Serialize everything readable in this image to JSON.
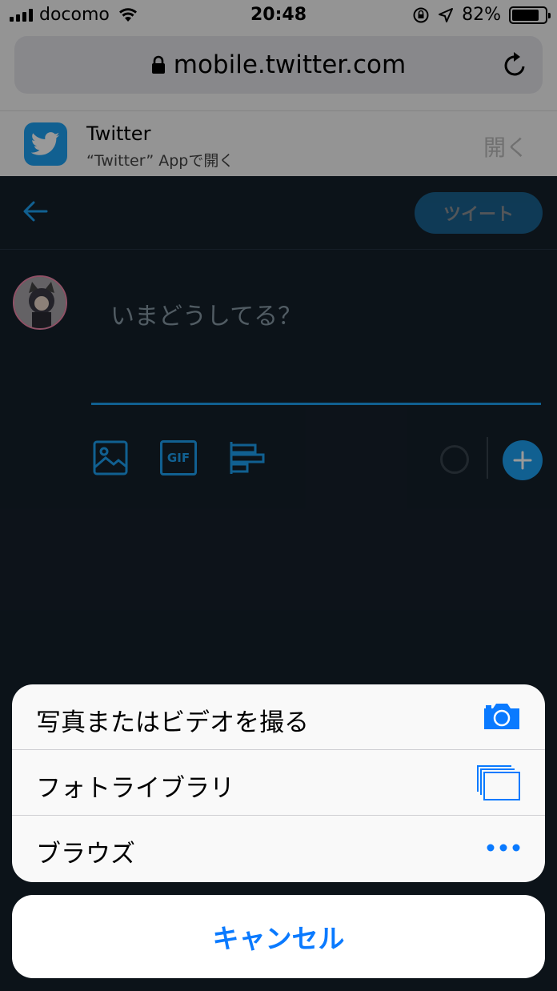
{
  "status_bar": {
    "carrier": "docomo",
    "time": "20:48",
    "battery": "82%",
    "battery_level": 0.82
  },
  "browser": {
    "url": "mobile.twitter.com"
  },
  "app_banner": {
    "title": "Twitter",
    "subtitle": "“Twitter” Appで開く",
    "open_label": "開く"
  },
  "compose": {
    "tweet_button": "ツイート",
    "placeholder": "いまどうしてる？",
    "gif_label": "GIF"
  },
  "action_sheet": {
    "items": [
      {
        "label": "写真またはビデオを撮る",
        "icon": "camera-icon"
      },
      {
        "label": "フォトライブラリ",
        "icon": "photo-library-icon"
      },
      {
        "label": "ブラウズ",
        "icon": "more-dots-icon"
      }
    ],
    "cancel_label": "キャンセル"
  },
  "colors": {
    "twitter_blue": "#1da1f2",
    "app_background": "#15202b",
    "ios_blue": "#0a7aff"
  }
}
